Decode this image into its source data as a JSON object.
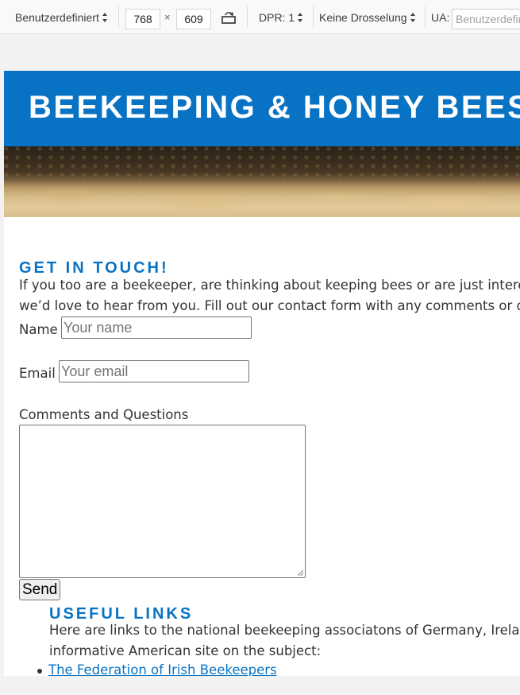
{
  "toolbar": {
    "device": "Benutzerdefiniert",
    "width": "768",
    "times": "×",
    "height": "609",
    "dpr": "DPR: 1",
    "throttling": "Keine Drosselung",
    "ua_label": "UA:",
    "ua_placeholder": "Benutzerdefiniert"
  },
  "page": {
    "banner_title": "BEEKEEPING & HONEY BEES",
    "contact": {
      "heading": "GET IN TOUCH!",
      "intro_line1": "If you too are a beekeeper, are thinking about keeping bees or are just interested",
      "intro_line2": "we’d love to hear from you. Fill out our contact form with any comments or questions.",
      "name_label": "Name",
      "name_placeholder": "Your name",
      "email_label": "Email",
      "email_placeholder": "Your email",
      "comments_label": "Comments and Questions",
      "send_label": "Send"
    },
    "links": {
      "heading": "USEFUL LINKS",
      "intro_line1": "Here are links to the national beekeeping associatons of Germany, Ireland",
      "intro_line2": "informative American site on the subject:",
      "items": [
        "The Federation of Irish Beekeepers"
      ]
    }
  },
  "colors": {
    "accent": "#0873c4",
    "text": "#333333"
  }
}
